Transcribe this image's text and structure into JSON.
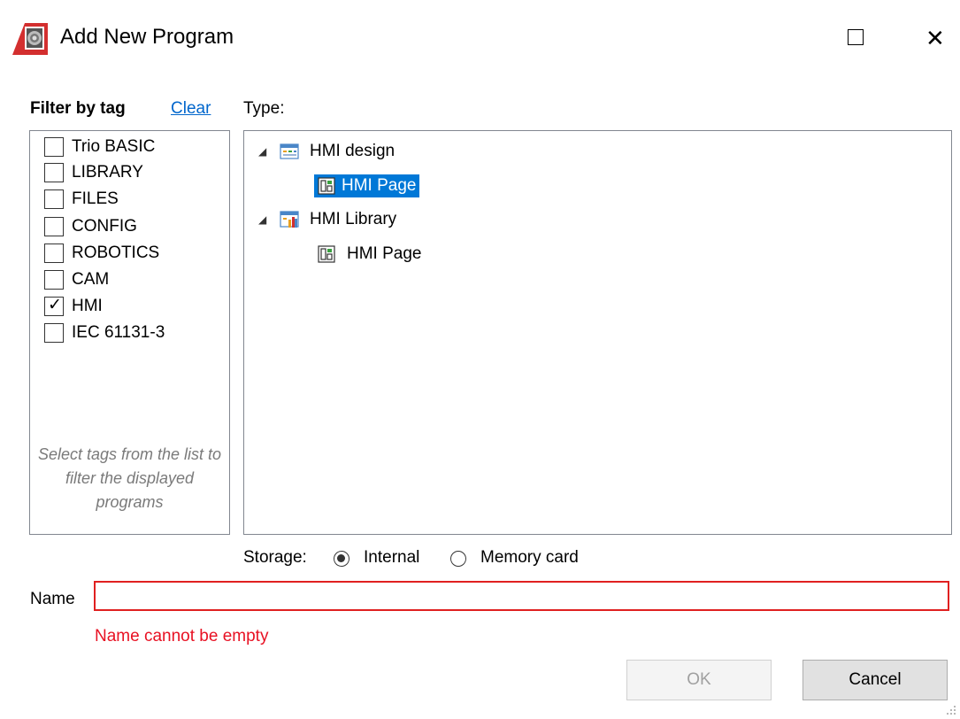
{
  "window": {
    "title": "Add New Program",
    "maximize_icon": "maximize-icon",
    "close_icon": "close-icon",
    "close_glyph": "✕"
  },
  "filter": {
    "label": "Filter by tag",
    "clear_label": "Clear",
    "tags": [
      {
        "label": "Trio BASIC",
        "checked": false
      },
      {
        "label": "LIBRARY",
        "checked": false
      },
      {
        "label": "FILES",
        "checked": false
      },
      {
        "label": "CONFIG",
        "checked": false
      },
      {
        "label": "ROBOTICS",
        "checked": false
      },
      {
        "label": "CAM",
        "checked": false
      },
      {
        "label": "HMI",
        "checked": true
      },
      {
        "label": "IEC 61131-3",
        "checked": false
      }
    ],
    "hint": "Select tags from the list to filter the displayed programs"
  },
  "type": {
    "label": "Type:",
    "tree": [
      {
        "label": "HMI design",
        "expanded": true,
        "children": [
          {
            "label": "HMI Page",
            "selected": true
          }
        ]
      },
      {
        "label": "HMI Library",
        "expanded": true,
        "children": [
          {
            "label": "HMI Page",
            "selected": false
          }
        ]
      }
    ]
  },
  "storage": {
    "label": "Storage:",
    "options": [
      {
        "label": "Internal",
        "selected": true
      },
      {
        "label": "Memory card",
        "selected": false
      }
    ]
  },
  "name": {
    "label": "Name",
    "value": "",
    "error": "Name cannot be empty"
  },
  "buttons": {
    "ok": "OK",
    "cancel": "Cancel",
    "ok_enabled": false
  },
  "colors": {
    "accent": "#0078d7",
    "error": "#e81123",
    "brand": "#d32f2f"
  }
}
